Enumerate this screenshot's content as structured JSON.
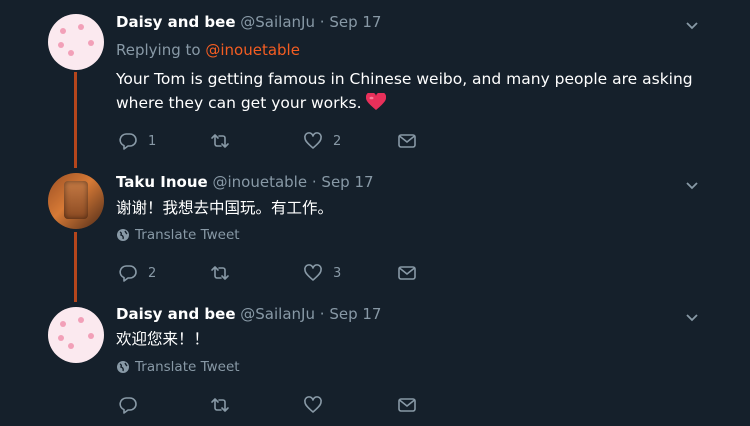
{
  "tweets": [
    {
      "name": "Daisy and bee",
      "handle": "@SailanJu",
      "separator": "·",
      "date": "Sep 17",
      "replying_label": "Replying to",
      "replying_mention": "@inouetable",
      "text": "Your Tom is getting famous in Chinese weibo, and many people are asking where they can get your works.",
      "emoji": "heart",
      "reply_count": "1",
      "retweet_count": "",
      "like_count": "2"
    },
    {
      "name": "Taku Inoue",
      "handle": "@inouetable",
      "separator": "·",
      "date": "Sep 17",
      "text": "谢谢！我想去中国玩。有工作。",
      "translate_label": "Translate Tweet",
      "reply_count": "2",
      "retweet_count": "",
      "like_count": "3"
    },
    {
      "name": "Daisy and bee",
      "handle": "@SailanJu",
      "separator": "·",
      "date": "Sep 17",
      "text": "欢迎您来！！",
      "translate_label": "Translate Tweet",
      "reply_count": "",
      "retweet_count": "",
      "like_count": ""
    }
  ],
  "colors": {
    "background": "#15202b",
    "thread_line": "#b5461c",
    "secondary_text": "#8899a6",
    "mention": "#f45d22",
    "heart_emoji": "#e8305a"
  },
  "icons": [
    "chevron-down-icon",
    "reply-icon",
    "retweet-icon",
    "like-icon",
    "share-icon",
    "globe-icon",
    "red-heart-emoji"
  ]
}
